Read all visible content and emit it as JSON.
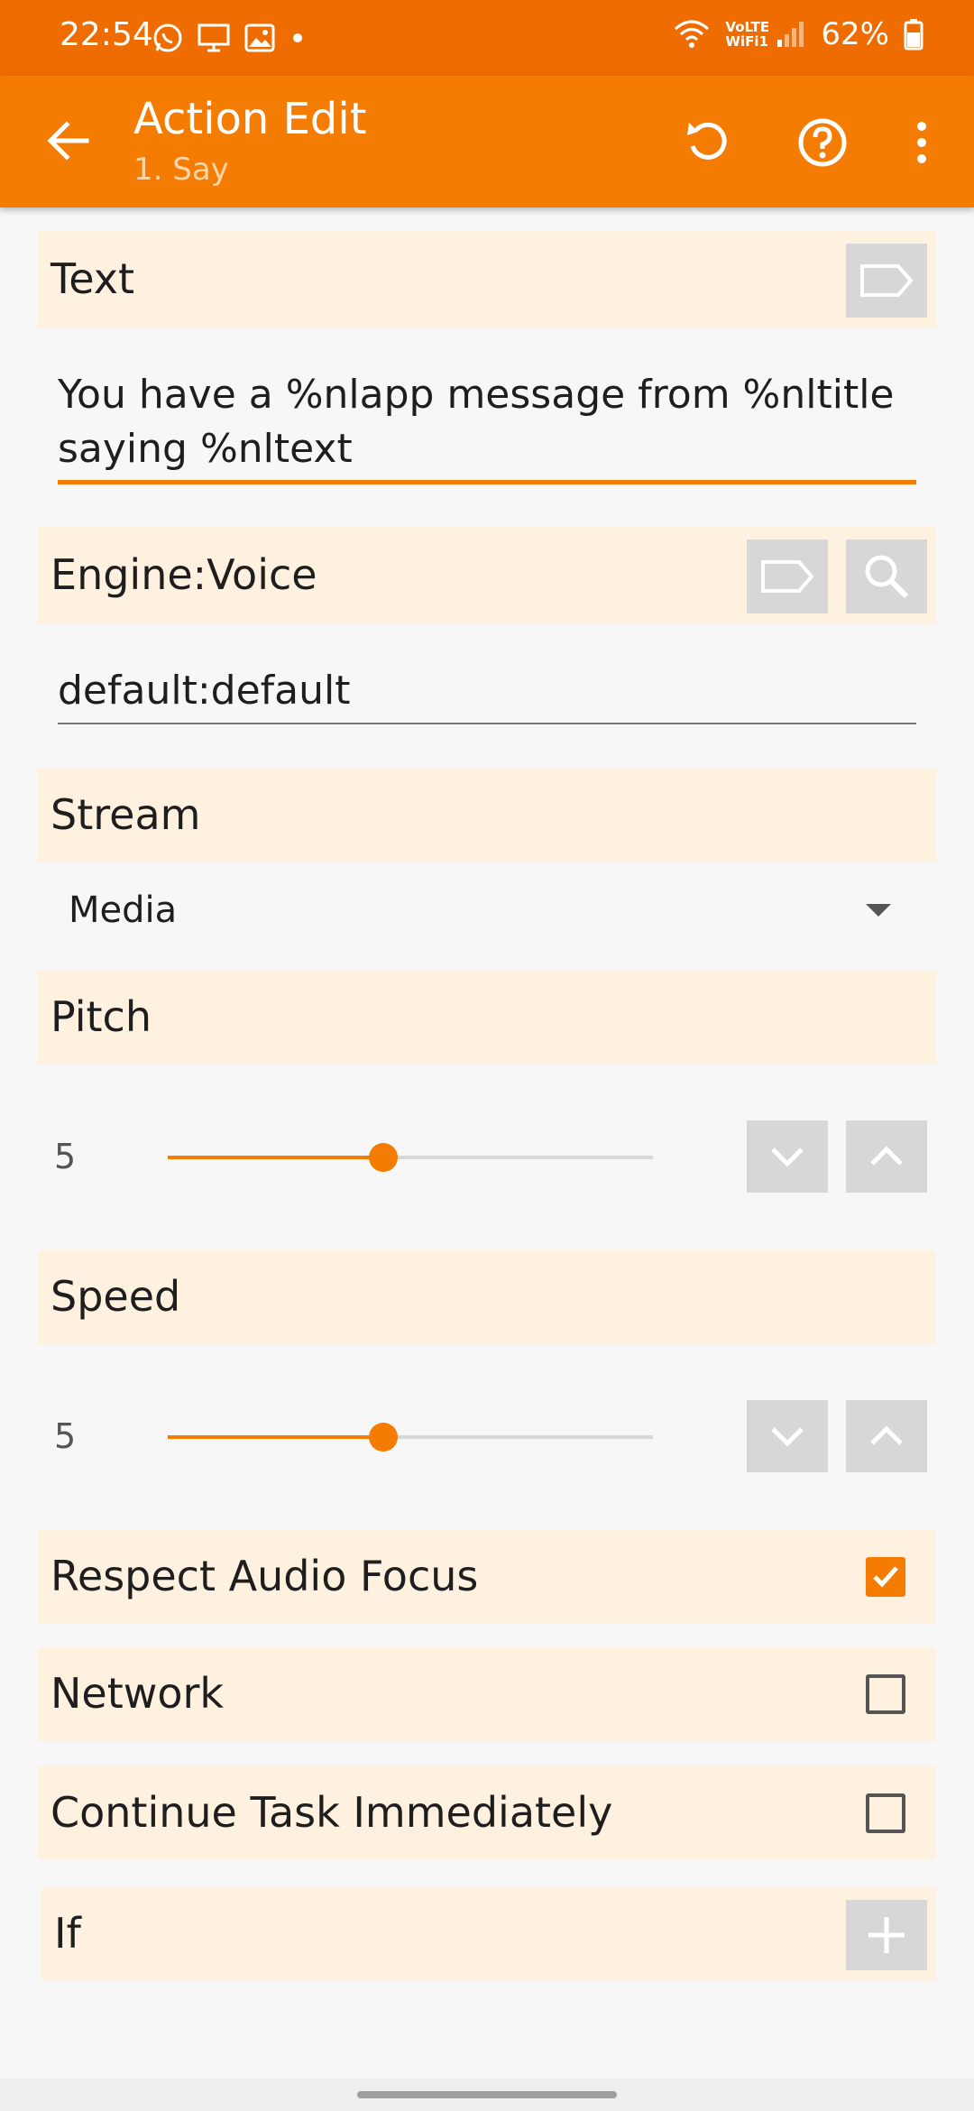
{
  "status_bar": {
    "time": "22:54",
    "left_icons": [
      "whatsapp-icon",
      "monitor-icon",
      "gallery-icon",
      "dot-icon"
    ],
    "network_label": "VoLTE WiFi1",
    "battery": "62%"
  },
  "app_bar": {
    "title": "Action Edit",
    "subtitle": "1. Say",
    "actions": [
      "undo-icon",
      "help-icon",
      "more-vert-icon"
    ]
  },
  "fields": {
    "text": {
      "label": "Text",
      "value_line1": "You have a %nlapp message from %nltitle",
      "value_line2": "saying %nltext"
    },
    "engine_voice": {
      "label": "Engine:Voice",
      "value": "default:default"
    },
    "stream": {
      "label": "Stream",
      "selected": "Media"
    },
    "pitch": {
      "label": "Pitch",
      "value": "5",
      "level": 0.5
    },
    "speed": {
      "label": "Speed",
      "value": "5",
      "level": 0.5
    },
    "respect_audio_focus": {
      "label": "Respect Audio Focus",
      "checked": true
    },
    "network": {
      "label": "Network",
      "checked": false
    },
    "continue_task": {
      "label": "Continue Task Immediately",
      "checked": false
    },
    "if": {
      "label": "If"
    }
  },
  "colors": {
    "accent": "#f47c02",
    "status_bar": "#ee6c00",
    "section_bg": "#fff1df",
    "button_grey": "#d7d7d7"
  }
}
